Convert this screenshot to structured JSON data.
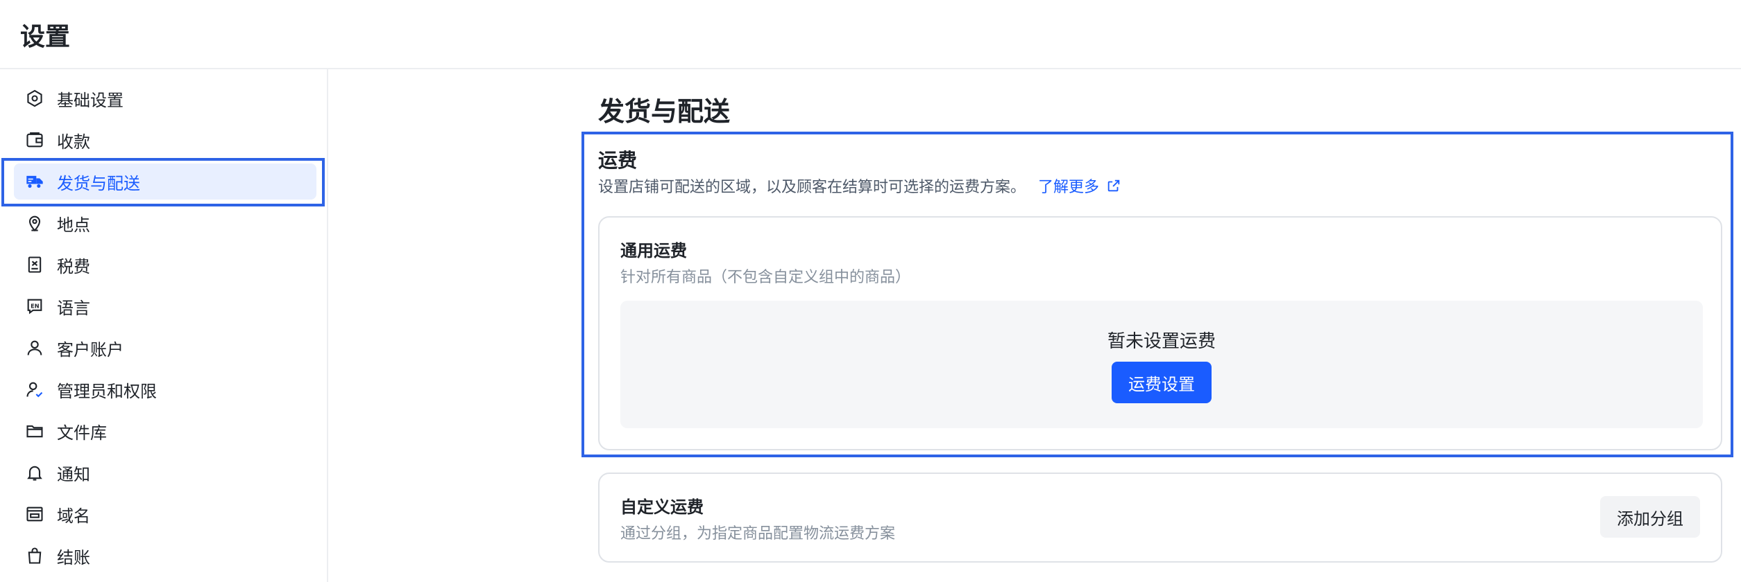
{
  "header": {
    "title": "设置"
  },
  "sidebar": {
    "items": [
      {
        "label": "基础设置",
        "icon": "settings-hex-icon"
      },
      {
        "label": "收款",
        "icon": "wallet-icon"
      },
      {
        "label": "发货与配送",
        "icon": "truck-icon",
        "active": true
      },
      {
        "label": "地点",
        "icon": "location-pin-icon"
      },
      {
        "label": "税费",
        "icon": "receipt-icon"
      },
      {
        "label": "语言",
        "icon": "language-en-icon"
      },
      {
        "label": "客户账户",
        "icon": "user-icon"
      },
      {
        "label": "管理员和权限",
        "icon": "user-check-icon"
      },
      {
        "label": "文件库",
        "icon": "folder-icon"
      },
      {
        "label": "通知",
        "icon": "bell-icon"
      },
      {
        "label": "域名",
        "icon": "domain-icon"
      },
      {
        "label": "结账",
        "icon": "bag-icon"
      }
    ]
  },
  "main": {
    "title": "发货与配送",
    "shipping": {
      "title": "运费",
      "description": "设置店铺可配送的区域，以及顾客在结算时可选择的运费方案。",
      "learn_more": "了解更多",
      "general": {
        "title": "通用运费",
        "subtitle": "针对所有商品（不包含自定义组中的商品）",
        "empty_text": "暂未设置运费",
        "button": "运费设置"
      },
      "custom": {
        "title": "自定义运费",
        "subtitle": "通过分组，为指定商品配置物流运费方案",
        "button": "添加分组"
      }
    }
  },
  "colors": {
    "accent": "#1a5cff",
    "highlight": "#2e63e6",
    "active_bg": "#e8efff"
  }
}
